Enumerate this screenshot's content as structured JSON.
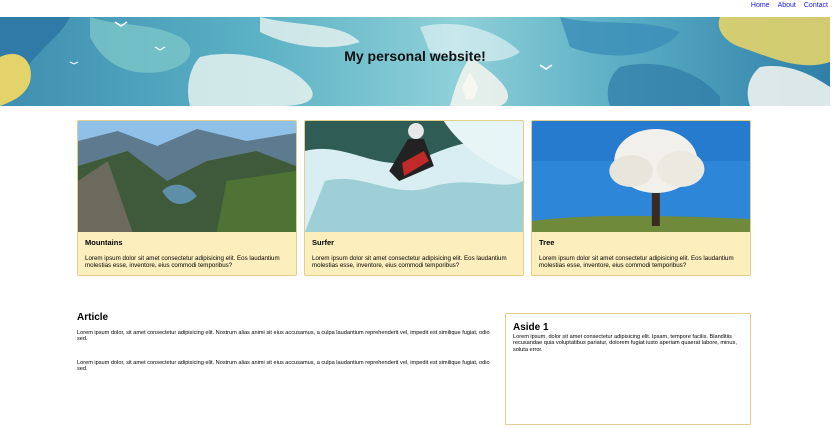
{
  "nav": {
    "items": [
      "Home",
      "About",
      "Contact"
    ]
  },
  "banner": {
    "title": "My personal website!"
  },
  "cards": [
    {
      "title": "Mountains",
      "text": "Lorem ipsum dolor sit amet consectetur adipisicing elit. Eos laudantium molestias esse, inventore, eius commodi temporibus?"
    },
    {
      "title": "Surfer",
      "text": "Lorem ipsum dolor sit amet consectetur adipisicing elit. Eos laudantium molestias esse, inventore, eius commodi temporibus?"
    },
    {
      "title": "Tree",
      "text": "Lorem ipsum dolor sit amet consectetur adipisicing elit. Eos laudantium molestias esse, inventore, eius commodi temporibus?"
    }
  ],
  "article": {
    "heading": "Article",
    "paragraphs": [
      "Lorem ipsum dolor, sit amet consectetur adipisicing elit. Nostrum alias animi sit eius accusamus, a culpa laudantium reprehenderit vel, impedit est similique fugiat, odio sed.",
      "Lorem ipsum dolor, sit amet consectetur adipisicing elit. Nostrum alias animi sit eius accusamus, a culpa laudantium reprehenderit vel, impedit est similique fugiat, odio sed."
    ]
  },
  "aside": {
    "heading": "Aside 1",
    "text": "Lorem ipsum, dolor sit amet consectetur adipisicing elit. Ipsam, tempore facilis. Blanditiis recusandae quia voluptatibus pariatur, dolorem fugiat iusto aperiam quaerat labore, minus, soluta error."
  },
  "colors": {
    "link": "#1a1aee",
    "card_background": "#fcefbd",
    "card_border": "#e2cf8d"
  }
}
